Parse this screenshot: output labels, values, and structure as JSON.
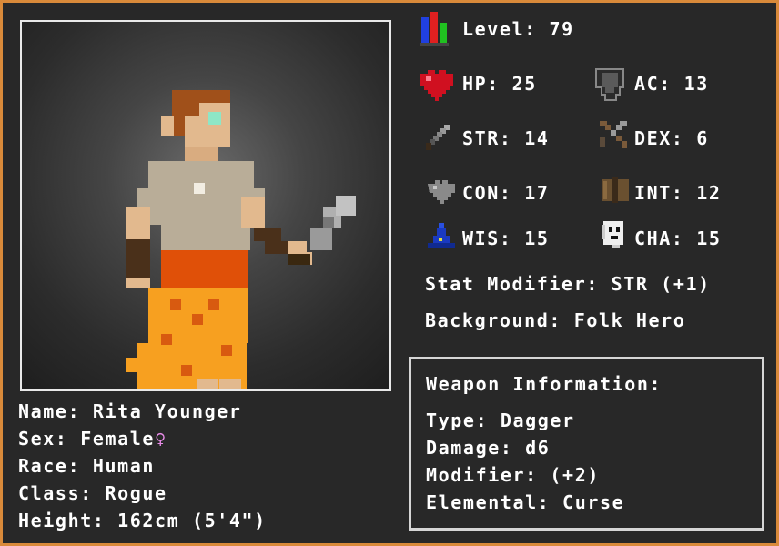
{
  "level": {
    "label": "Level:",
    "value": "79"
  },
  "stats": {
    "hp": {
      "label": "HP:",
      "value": "25",
      "icon": "heart-icon",
      "color": "#d01020"
    },
    "ac": {
      "label": "AC:",
      "value": "13",
      "icon": "shield-icon",
      "color": "#555555"
    },
    "str": {
      "label": "STR:",
      "value": "14",
      "icon": "sword-icon"
    },
    "dex": {
      "label": "DEX:",
      "value": "6",
      "icon": "bow-icon"
    },
    "con": {
      "label": "CON:",
      "value": "17",
      "icon": "grey-heart-icon"
    },
    "int": {
      "label": "INT:",
      "value": "12",
      "icon": "book-icon"
    },
    "wis": {
      "label": "WIS:",
      "value": "15",
      "icon": "wizard-hat-icon",
      "color": "#2040c0"
    },
    "cha": {
      "label": "CHA:",
      "value": "15",
      "icon": "mask-icon"
    }
  },
  "stat_modifier": "Stat Modifier: STR (+1)",
  "background": "Background: Folk Hero",
  "character": {
    "name": "Name: Rita Younger",
    "sex": "Sex: Female",
    "sex_symbol": "♀",
    "race": "Race: Human",
    "class": "Class: Rogue",
    "height": "Height: 162cm (5'4\")"
  },
  "weapon": {
    "title": "Weapon Information:",
    "type": "Type: Dagger",
    "damage": "Damage: d6",
    "modifier": "Modifier: (+2)",
    "elemental": "Elemental: Curse"
  },
  "colors": {
    "border": "#d98a3a",
    "background": "#282828",
    "text": "#ffffff"
  }
}
